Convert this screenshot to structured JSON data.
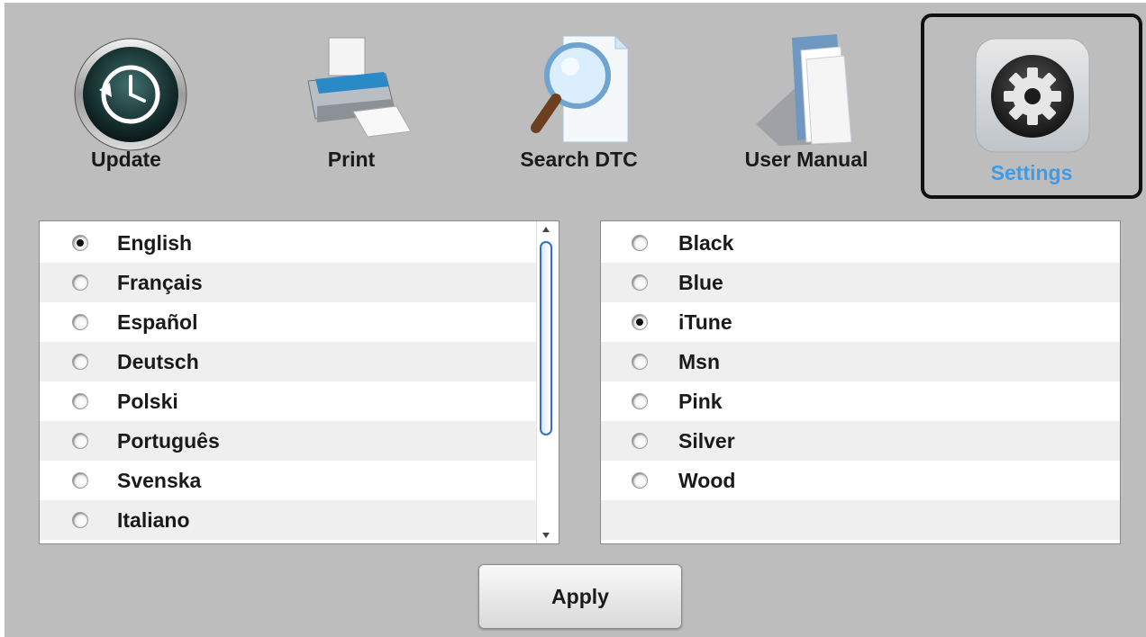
{
  "toolbar": {
    "items": [
      {
        "label": "Update",
        "icon": "update-clock-icon"
      },
      {
        "label": "Print",
        "icon": "printer-icon"
      },
      {
        "label": "Search DTC",
        "icon": "magnifier-document-icon"
      },
      {
        "label": "User Manual",
        "icon": "manual-document-icon"
      },
      {
        "label": "Settings",
        "icon": "gear-icon",
        "active": true
      }
    ]
  },
  "languages": {
    "selected": "English",
    "items": [
      {
        "label": "English",
        "checked": true
      },
      {
        "label": "Français",
        "checked": false
      },
      {
        "label": "Español",
        "checked": false
      },
      {
        "label": "Deutsch",
        "checked": false
      },
      {
        "label": "Polski",
        "checked": false
      },
      {
        "label": "Português",
        "checked": false
      },
      {
        "label": "Svenska",
        "checked": false
      },
      {
        "label": "Italiano",
        "checked": false
      }
    ]
  },
  "skins": {
    "selected": "iTune",
    "items": [
      {
        "label": "Black",
        "checked": false
      },
      {
        "label": "Blue",
        "checked": false
      },
      {
        "label": "iTune",
        "checked": true
      },
      {
        "label": "Msn",
        "checked": false
      },
      {
        "label": "Pink",
        "checked": false
      },
      {
        "label": "Silver",
        "checked": false
      },
      {
        "label": "Wood",
        "checked": false
      }
    ]
  },
  "apply_label": "Apply",
  "colors": {
    "background": "#bdbdbd",
    "active_label": "#3d9be9",
    "row_alt": "#efefef"
  }
}
